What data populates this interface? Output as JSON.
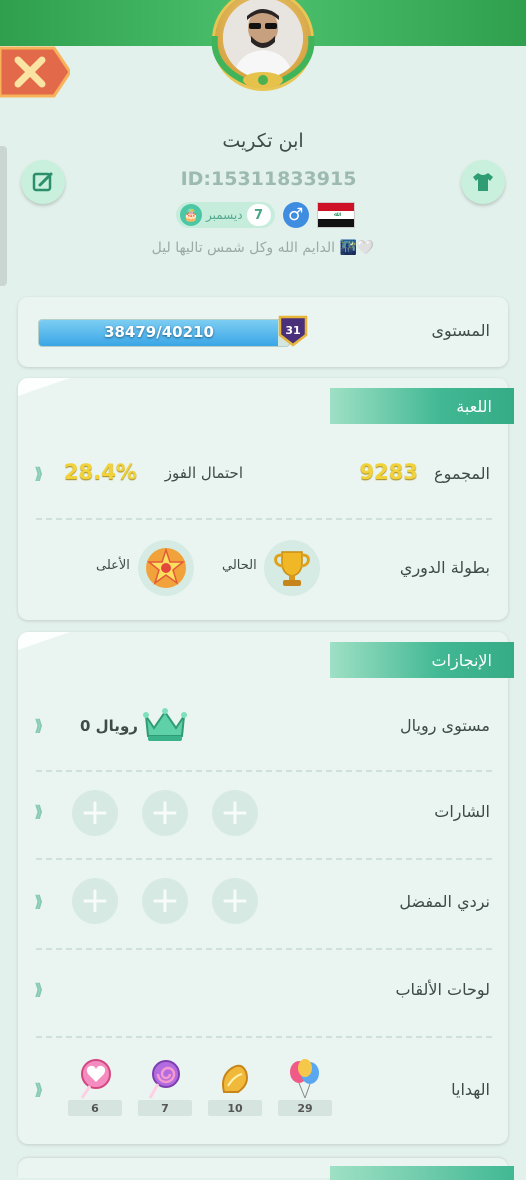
{
  "profile": {
    "name": "ابن تكريت",
    "id_text": "ID:15311833915",
    "birthday_day": "7",
    "birthday_month": "ديسمبر",
    "gender_symbol": "♂",
    "status": "الدايم الله وكل شمس تاليها ليل 🌃🤍"
  },
  "level": {
    "label": "المستوى",
    "progress_text": "38479/40210",
    "current": 38479,
    "max": 40210,
    "level_number": "31"
  },
  "game": {
    "title": "اللعبة",
    "total_label": "المجموع",
    "total_value": "9283",
    "win_label": "احتمال الفوز",
    "win_value": "28.4%",
    "league_label": "بطولة الدوري",
    "current_label": "الحالي",
    "highest_label": "الأعلى"
  },
  "achievements": {
    "title": "الإنجازات",
    "royal_label": "مستوى رويال",
    "royal_value": "رويال 0",
    "badges_label": "الشارات",
    "dice_label": "نردي المفضل",
    "title_plates_label": "لوحات الألقاب",
    "gifts_label": "الهدايا",
    "gifts": [
      {
        "name": "heart-lollipop",
        "count": "6"
      },
      {
        "name": "swirl-lollipop",
        "count": "7"
      },
      {
        "name": "golden-gift",
        "count": "10"
      },
      {
        "name": "balloons",
        "count": "29"
      }
    ]
  },
  "colors": {
    "background": "#e3f1ec",
    "accent": "#41b893",
    "gold": "#f1d23a",
    "progress": "#3aa6e6"
  }
}
